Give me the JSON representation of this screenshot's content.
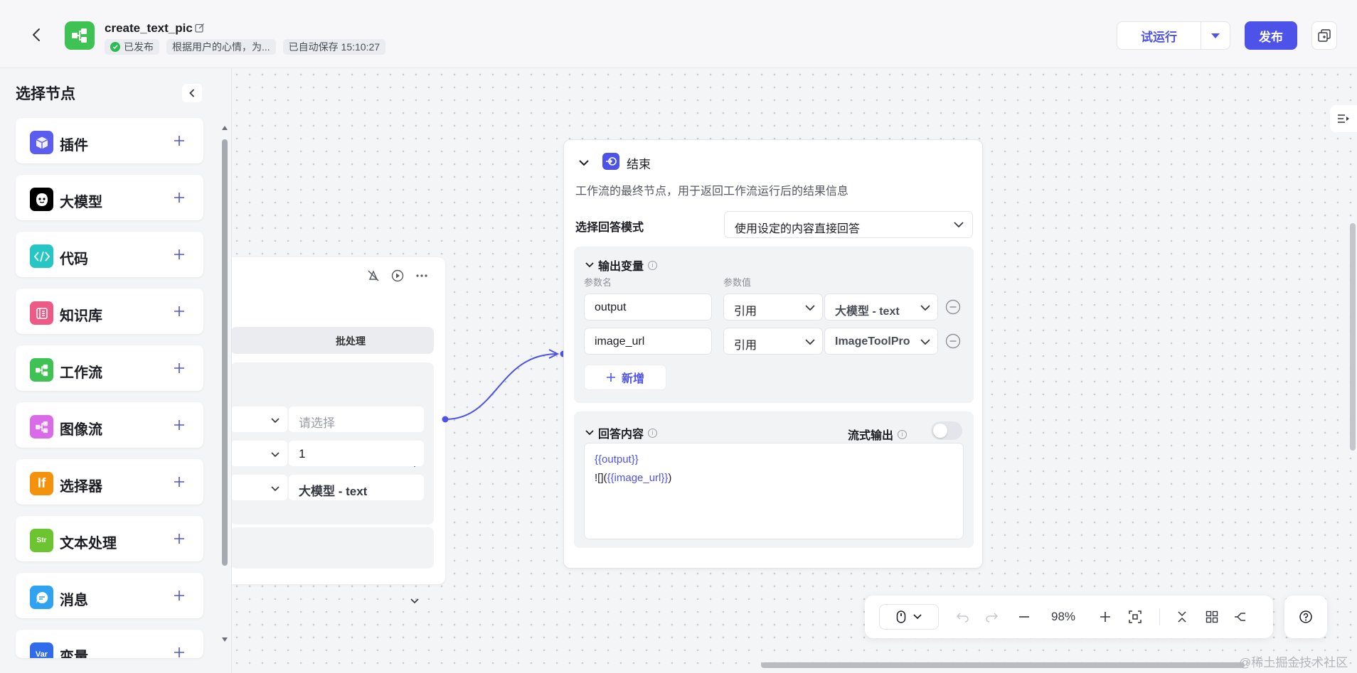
{
  "header": {
    "app_title": "create_text_pic",
    "status": "已发布",
    "description": "根据用户的心情，为...",
    "autosave": "已自动保存 15:10:27",
    "run_label": "试运行",
    "publish_label": "发布"
  },
  "sidebar": {
    "title": "选择节点",
    "items": [
      {
        "label": "插件",
        "icon": "cube-icon",
        "color": "#5b5cf0"
      },
      {
        "label": "大模型",
        "icon": "llm-face-icon",
        "color": "#1c1d23"
      },
      {
        "label": "代码",
        "icon": "code-icon",
        "color": "#26c6c4"
      },
      {
        "label": "知识库",
        "icon": "knowledge-icon",
        "color": "#ec5a85"
      },
      {
        "label": "工作流",
        "icon": "workflow-icon",
        "color": "#3ec254"
      },
      {
        "label": "图像流",
        "icon": "imageflow-icon",
        "color": "#d96be8"
      },
      {
        "label": "选择器",
        "icon": "if-icon",
        "color": "#f5920b"
      },
      {
        "label": "文本处理",
        "icon": "str-icon",
        "color": "#6cc431"
      },
      {
        "label": "消息",
        "icon": "message-icon",
        "color": "#2fa3f2"
      },
      {
        "label": "变量",
        "icon": "var-icon",
        "color": "#2f6bea"
      }
    ]
  },
  "left_node": {
    "batch_tab": "批处理",
    "rows": [
      {
        "value": "请选择"
      },
      {
        "value": "1"
      },
      {
        "value": "大模型 - text"
      }
    ]
  },
  "end_node": {
    "title": "结束",
    "description": "工作流的最终节点，用于返回工作流运行后的结果信息",
    "mode_label": "选择回答模式",
    "mode_value": "使用设定的内容直接回答",
    "output_section": {
      "title": "输出变量",
      "col_name": "参数名",
      "col_value": "参数值",
      "rows": [
        {
          "name": "output",
          "type": "引用",
          "source": "大模型 - text"
        },
        {
          "name": "image_url",
          "type": "引用",
          "source": "ImageToolPro"
        }
      ],
      "add_label": "新增"
    },
    "answer_section": {
      "title": "回答内容",
      "stream_label": "流式输出",
      "line1": "{{output}}",
      "line2_prefix": "![](",
      "line2_var": "{{image_url}}",
      "line2_suffix": ")"
    }
  },
  "toolbar": {
    "zoom": "98%"
  },
  "watermark": "@稀土掘金技术社区"
}
